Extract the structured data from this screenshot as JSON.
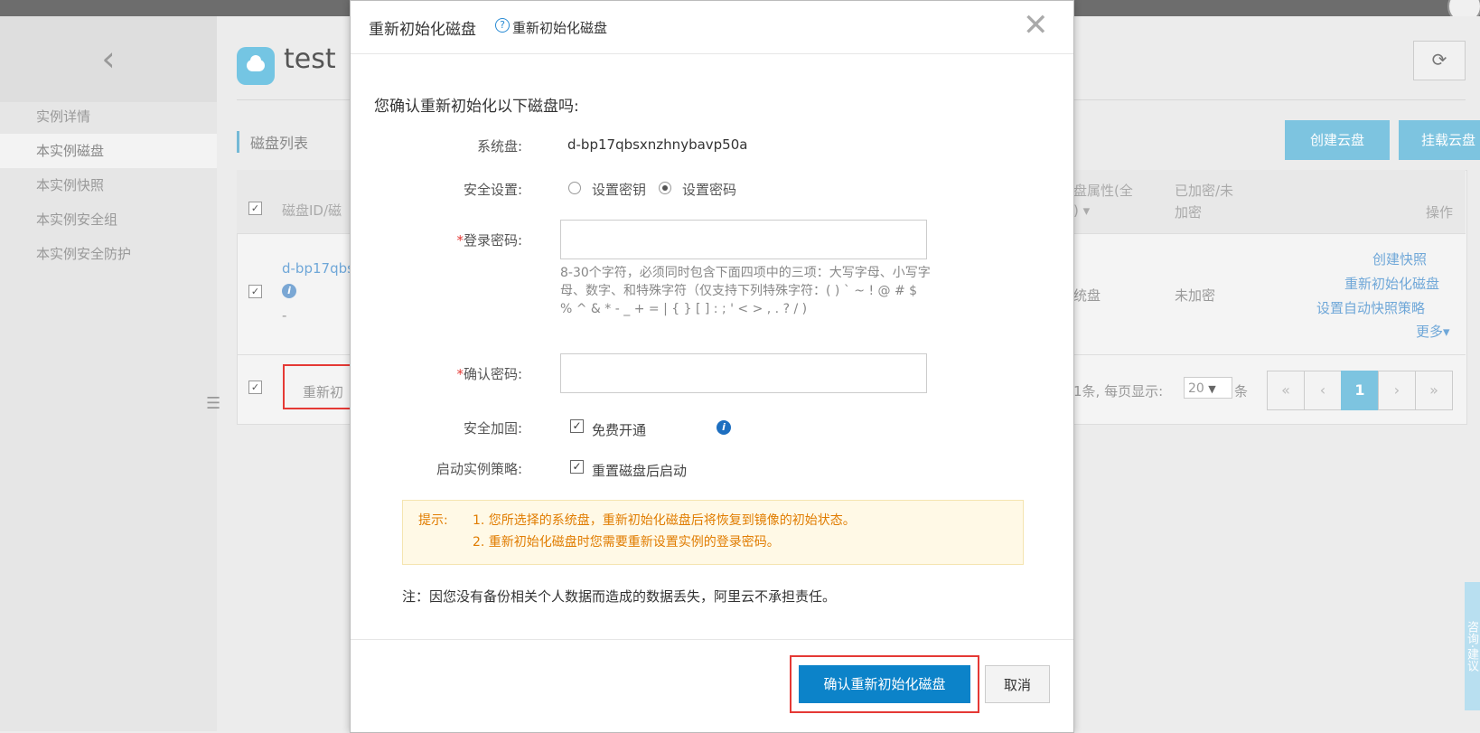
{
  "sidebar": {
    "back_icon": "chevron-left-icon",
    "items": [
      {
        "label": "实例详情"
      },
      {
        "label": "本实例磁盘"
      },
      {
        "label": "本实例快照"
      },
      {
        "label": "本实例安全组"
      },
      {
        "label": "本实例安全防护"
      }
    ]
  },
  "header": {
    "title": "test",
    "icon": "cloud-icon",
    "refresh_icon": "refresh-icon"
  },
  "disk_list": {
    "section_title": "磁盘列表",
    "create_button": "创建云盘",
    "attach_button": "挂载云盘",
    "columns": {
      "id": "磁盘ID/磁",
      "attr_line1": "盘属性(全",
      "attr_line2": ")",
      "encrypt_line1": "已加密/未",
      "encrypt_line2": "加密",
      "ops": "操作"
    },
    "row": {
      "id": "d-bp17qbs",
      "dash": "-",
      "attr": "统盘",
      "encrypted": "未加密",
      "op_snapshot": "创建快照",
      "op_reinit": "重新初始化磁盘",
      "op_auto": "设置自动快照策略",
      "op_more": "更多"
    },
    "footer": {
      "batch_action": "重新初",
      "summary": "1条, 每页显示:",
      "page_size": "20",
      "unit": "条",
      "pages": [
        "«",
        "‹",
        "1",
        "›",
        "»"
      ]
    }
  },
  "side_tab": "咨询·建议",
  "modal": {
    "title": "重新初始化磁盘",
    "help_label": "重新初始化磁盘",
    "question": "您确认重新初始化以下磁盘吗:",
    "system_disk_label": "系统盘:",
    "system_disk_value": "d-bp17qbsxnzhnybavp50a",
    "security_label": "安全设置:",
    "option_key": "设置密钥",
    "option_password": "设置密码",
    "selected_option": "设置密码",
    "login_password_label": "登录密码:",
    "password_hint": "8-30个字符，必须同时包含下面四项中的三项：大写字母、小写字母、数字、和特殊字符（仅支持下列特殊字符：( ) ` ~ ! @ # $ % ^ & * - _ + = | { } [ ] : ; ' < > , . ? / )",
    "confirm_password_label": "确认密码:",
    "hardening_label": "安全加固:",
    "hardening_option": "免费开通",
    "startup_label": "启动实例策略:",
    "startup_option": "重置磁盘后启动",
    "tip_label": "提示:",
    "tip1": "1. 您所选择的系统盘，重新初始化磁盘后将恢复到镜像的初始状态。",
    "tip2": "2. 重新初始化磁盘时您需要重新设置实例的登录密码。",
    "note": "注：因您没有备份相关个人数据而造成的数据丢失，阿里云不承担责任。",
    "confirm_button": "确认重新初始化磁盘",
    "cancel_button": "取消"
  }
}
